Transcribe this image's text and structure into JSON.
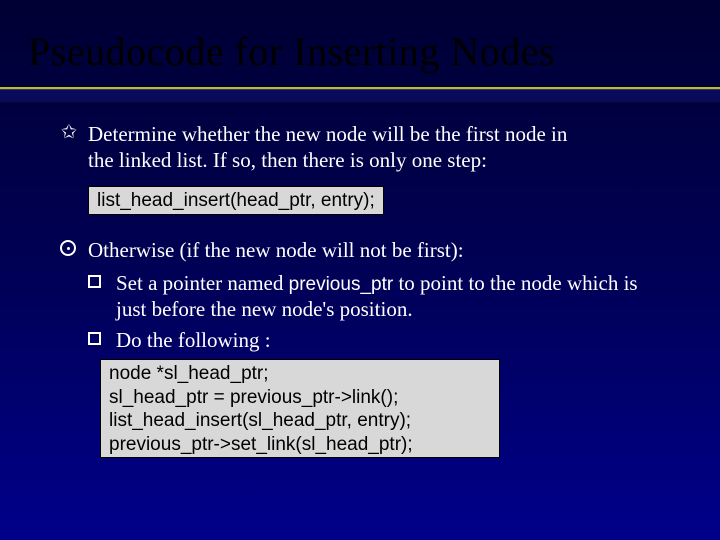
{
  "title": "Pseudocode for Inserting Nodes",
  "bullets": {
    "b1": {
      "text_a": "Determine whether the new node will be the first node in",
      "text_b": "the linked list.  If so, then there is only one step:"
    },
    "code1": "list_head_insert(head_ptr, entry);",
    "b2": {
      "text": "Otherwise (if the new node will not be first):"
    },
    "sub1": {
      "pre": "Set a pointer named ",
      "code": "previous_ptr",
      "post": " to point to the node which is just before the new node's position."
    },
    "sub2": {
      "text": "Do the following :"
    },
    "code2": "node *sl_head_ptr;\nsl_head_ptr = previous_ptr->link();\nlist_head_insert(sl_head_ptr, entry);\nprevious_ptr->set_link(sl_head_ptr);"
  }
}
